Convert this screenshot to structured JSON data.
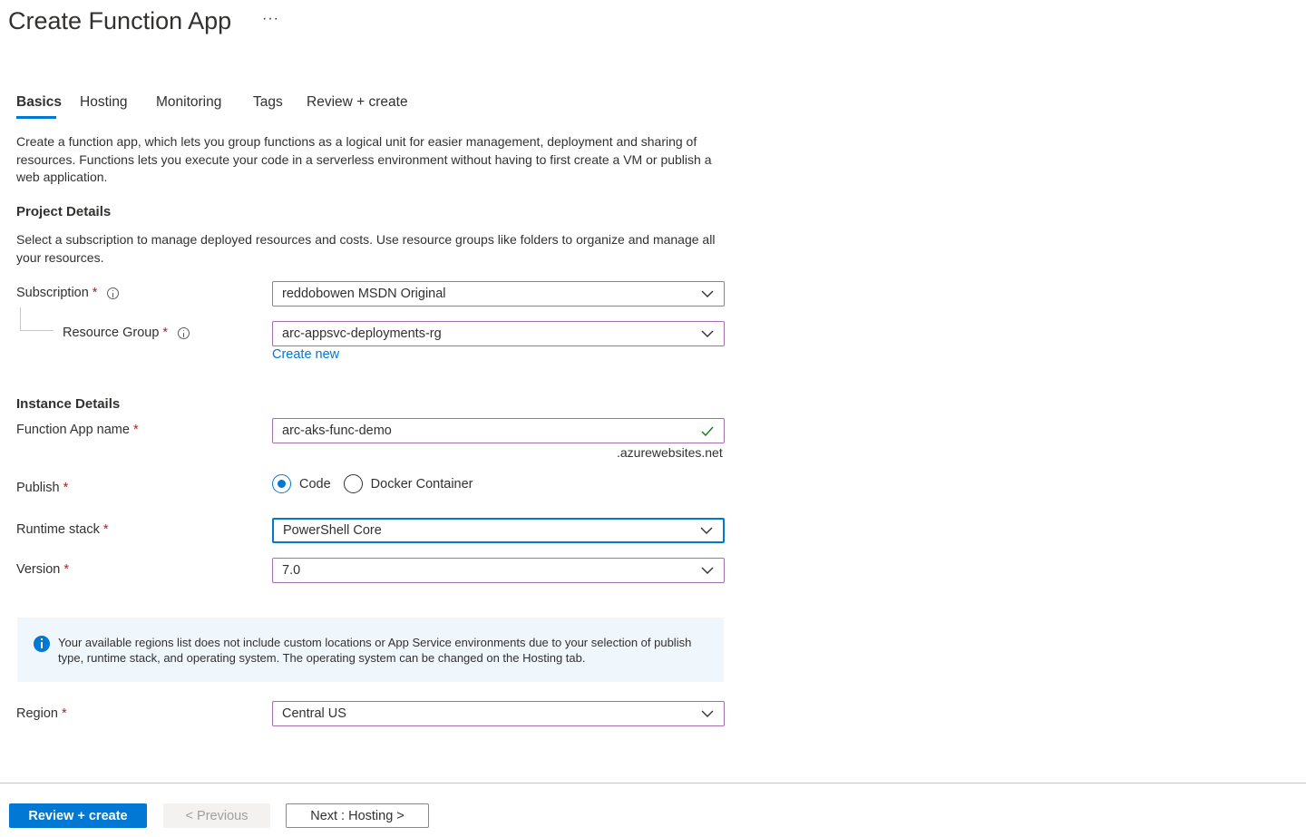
{
  "header": {
    "title": "Create Function App",
    "more": "···"
  },
  "tabs": [
    {
      "label": "Basics",
      "active": true
    },
    {
      "label": "Hosting"
    },
    {
      "label": "Monitoring"
    },
    {
      "label": "Tags"
    },
    {
      "label": "Review + create"
    }
  ],
  "intro": "Create a function app, which lets you group functions as a logical unit for easier management, deployment and sharing of resources. Functions lets you execute your code in a serverless environment without having to first create a VM or publish a web application.",
  "project": {
    "heading": "Project Details",
    "description": "Select a subscription to manage deployed resources and costs. Use resource groups like folders to organize and manage all your resources.",
    "subscription": {
      "label": "Subscription",
      "value": "reddobowen MSDN Original"
    },
    "resource_group": {
      "label": "Resource Group",
      "value": "arc-appsvc-deployments-rg",
      "create_new": "Create new"
    }
  },
  "instance": {
    "heading": "Instance Details",
    "function_app_name": {
      "label": "Function App name",
      "value": "arc-aks-func-demo",
      "suffix": ".azurewebsites.net"
    },
    "publish": {
      "label": "Publish",
      "options": [
        "Code",
        "Docker Container"
      ],
      "selected": "Code"
    },
    "runtime_stack": {
      "label": "Runtime stack",
      "value": "PowerShell Core"
    },
    "version": {
      "label": "Version",
      "value": "7.0"
    }
  },
  "info_message": "Your available regions list does not include custom locations or App Service environments due to your selection of publish type, runtime stack, and operating system. The operating system can be changed on the Hosting tab.",
  "region": {
    "label": "Region",
    "value": "Central US"
  },
  "required_marker": "*",
  "footer": {
    "review_create": "Review + create",
    "previous": "< Previous",
    "next": "Next : Hosting >"
  },
  "colors": {
    "accent": "#0078d4",
    "required": "#a4262c",
    "valid_check": "#107c10",
    "info_background": "#eff6fc"
  }
}
